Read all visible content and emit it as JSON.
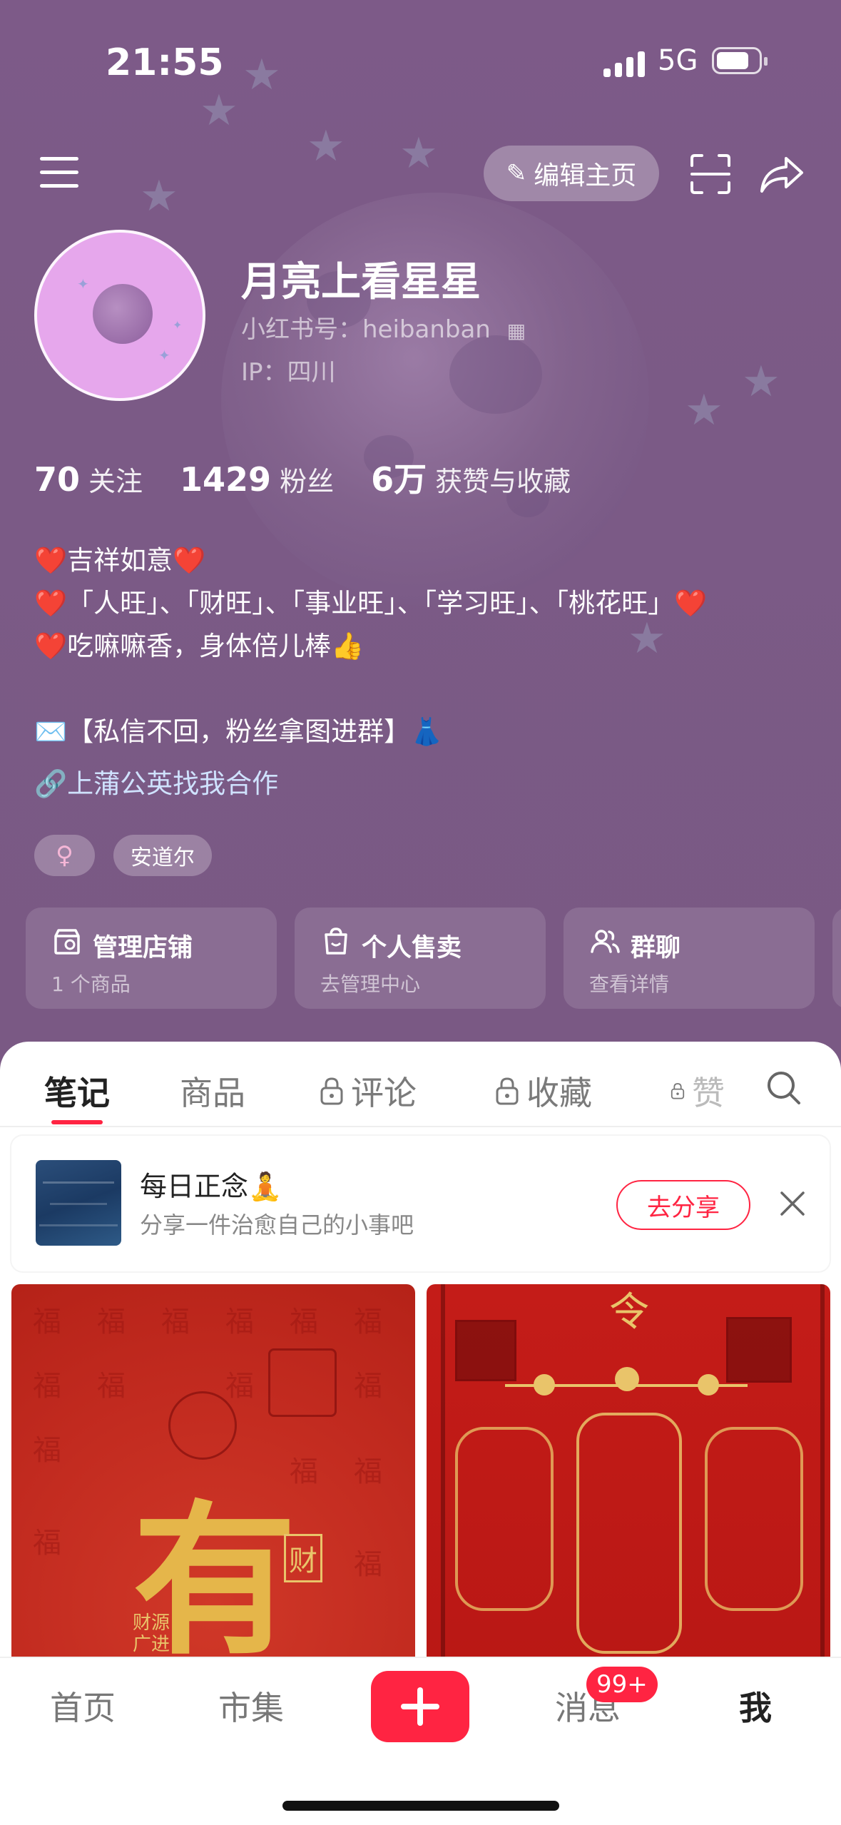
{
  "status_bar": {
    "time": "21:55",
    "network": "5G"
  },
  "top_nav": {
    "edit_label": "编辑主页"
  },
  "profile": {
    "nickname": "月亮上看星星",
    "red_id": "小红书号：heibanban",
    "ip": "IP：四川"
  },
  "stats": [
    {
      "value": "70",
      "label": "关注"
    },
    {
      "value": "1429",
      "label": "粉丝"
    },
    {
      "value": "6万",
      "label": "获赞与收藏"
    }
  ],
  "bio": {
    "line1": "❤️吉祥如意❤️",
    "line2": "❤️「人旺」、「财旺」、「事业旺」、「学习旺」、「桃花旺」❤️",
    "line3": "❤️吃嘛嘛香，身体倍儿棒👍",
    "line4": "✉️【私信不回，粉丝拿图进群】👗",
    "cooperation": "上蒲公英找我合作"
  },
  "tags": {
    "gender": "♀",
    "location": "安道尔"
  },
  "cards": [
    {
      "title": "管理店铺",
      "sub": "1 个商品"
    },
    {
      "title": "个人售卖",
      "sub": "去管理中心"
    },
    {
      "title": "群聊",
      "sub": "查看详情"
    }
  ],
  "tabs": [
    "笔记",
    "商品",
    "评论",
    "收藏",
    "赞"
  ],
  "daily": {
    "title": "每日正念🧘",
    "subtitle": "分享一件治愈自己的小事吧",
    "button": "去分享"
  },
  "notes": {
    "note1_char": "有",
    "note1_small": "财",
    "note1_seal": "财源广进",
    "note1_bg_char": "福",
    "note2_top": "令"
  },
  "bottom_nav": {
    "home": "首页",
    "market": "市集",
    "messages": "消息",
    "me": "我",
    "badge": "99+"
  },
  "colors": {
    "brand": "#ff2442",
    "header_bg": "#7b5a86",
    "link": "#cfe2ff"
  }
}
